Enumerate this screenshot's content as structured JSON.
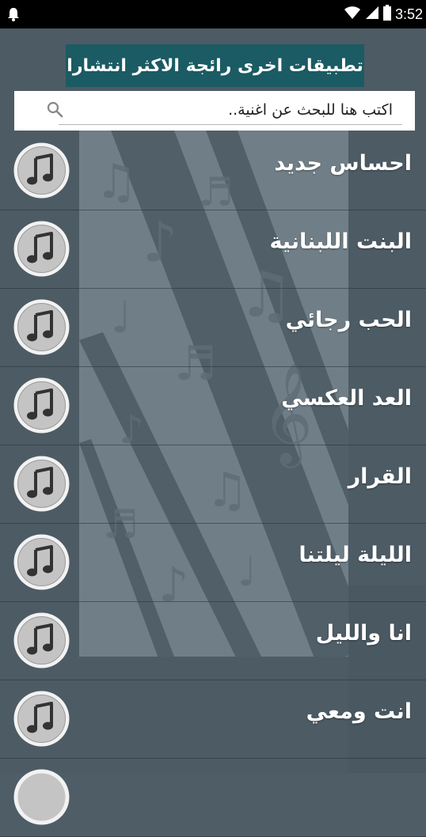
{
  "status_bar": {
    "time": "3:52"
  },
  "banner": {
    "label": "تطبيقات اخرى رائجة الاكثر انتشارا"
  },
  "search": {
    "placeholder": "اكتب هنا للبحث عن اغنية.."
  },
  "songs": [
    {
      "title": "احساس جديد"
    },
    {
      "title": "البنت اللبنانية"
    },
    {
      "title": "الحب رجائي"
    },
    {
      "title": "العد العكسي"
    },
    {
      "title": "القرار"
    },
    {
      "title": "الليلة ليلتنا"
    },
    {
      "title": "انا والليل"
    },
    {
      "title": "انت ومعي"
    }
  ],
  "colors": {
    "background": "#4e5d66",
    "banner": "#1b5b63",
    "status_bar": "#000000",
    "text": "#ffffff"
  },
  "icons": {
    "status_left": "bell-icon",
    "status_right": [
      "wifi-icon",
      "signal-icon",
      "battery-icon"
    ],
    "search": "search-icon",
    "song": "music-note-icon"
  }
}
